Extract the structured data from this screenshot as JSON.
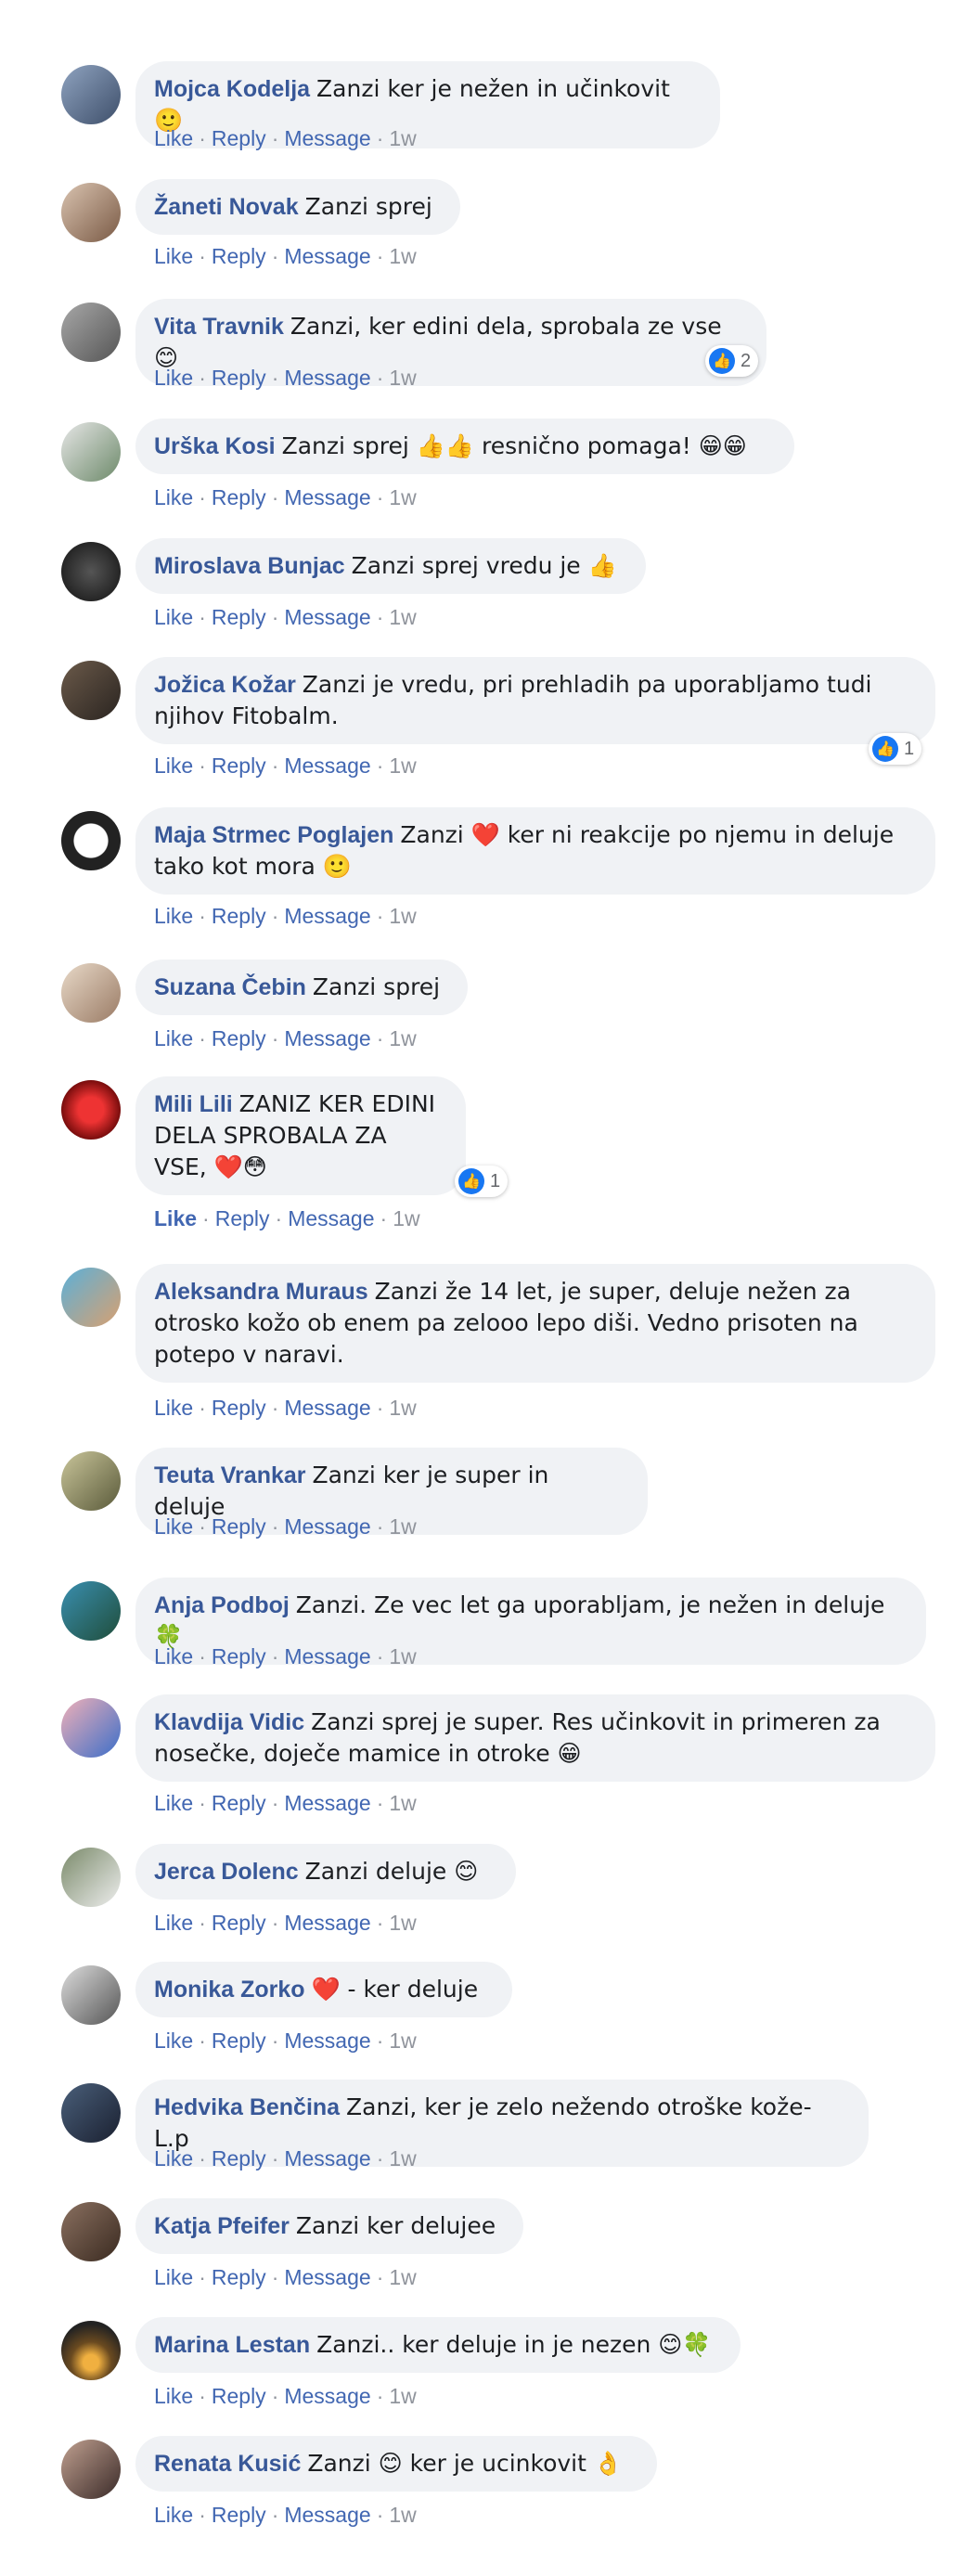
{
  "comments": [
    {
      "author": "Mojca Kodelja",
      "text": "Zanzi ker je nežen in učinkovit 🙂",
      "time": "1w",
      "reactions": ""
    },
    {
      "author": "Žaneti Novak",
      "text": "Zanzi sprej",
      "time": "1w",
      "reactions": ""
    },
    {
      "author": "Vita Travnik",
      "text": "Zanzi, ker edini dela, sprobala ze vse😊",
      "time": "1w",
      "reactions": "2"
    },
    {
      "author": "Urška Kosi",
      "text": "Zanzi sprej 👍👍 resnično pomaga! 😁😁",
      "time": "1w",
      "reactions": ""
    },
    {
      "author": "Miroslava Bunjac",
      "text": "Zanzi sprej vredu je 👍",
      "time": "1w",
      "reactions": ""
    },
    {
      "author": "Jožica Kožar",
      "text": "Zanzi je vredu, pri prehladih pa uporabljamo tudi njihov Fitobalm.",
      "time": "1w",
      "reactions": "1"
    },
    {
      "author": "Maja Strmec Poglajen",
      "text": "Zanzi ❤️ ker ni reakcije po njemu in deluje tako kot mora 🙂",
      "time": "1w",
      "reactions": ""
    },
    {
      "author": "Suzana Čebin",
      "text": "Zanzi sprej",
      "time": "1w",
      "reactions": ""
    },
    {
      "author": "Mili Lili",
      "text": "ZANIZ KER EDINI DELA SPROBALA ZA VSE, ❤️😳",
      "time": "1w",
      "reactions": "1"
    },
    {
      "author": "Aleksandra Muraus",
      "text": "Zanzi že 14 let, je super, deluje nežen za otrosko kožo ob enem pa zelooo lepo diši. Vedno prisoten na potepo v naravi.",
      "time": "1w",
      "reactions": ""
    },
    {
      "author": "Teuta Vrankar",
      "text": "Zanzi ker je super in deluje",
      "time": "1w",
      "reactions": ""
    },
    {
      "author": "Anja Podboj",
      "text": "Zanzi. Ze vec let ga uporabljam, je nežen in deluje🍀",
      "time": "1w",
      "reactions": ""
    },
    {
      "author": "Klavdija Vidic",
      "text": "Zanzi sprej je super. Res učinkovit in primeren za nosečke, doječe mamice in otroke 😁",
      "time": "1w",
      "reactions": ""
    },
    {
      "author": "Jerca Dolenc",
      "text": "Zanzi deluje 😊",
      "time": "1w",
      "reactions": ""
    },
    {
      "author": "Monika Zorko",
      "text": "❤️ - ker deluje",
      "time": "1w",
      "reactions": ""
    },
    {
      "author": "Hedvika Benčina",
      "text": "Zanzi, ker je zelo nežendo otroške kože-L.p",
      "time": "1w",
      "reactions": ""
    },
    {
      "author": "Katja Pfeifer",
      "text": "Zanzi ker delujee",
      "time": "1w",
      "reactions": ""
    },
    {
      "author": "Marina Lestan",
      "text": "Zanzi.. ker deluje in je nezen 😊🍀",
      "time": "1w",
      "reactions": ""
    },
    {
      "author": "Renata Kusić",
      "text": "Zanzi 😊 ker je ucinkovit 👌",
      "time": "1w",
      "reactions": ""
    }
  ],
  "actions": {
    "like": "Like",
    "reply": "Reply",
    "message": "Message",
    "sep": "·"
  },
  "colors": {
    "author": "#385898",
    "action": "#4267b2",
    "bubble": "#f0f2f5",
    "reaction": "#1877f2"
  }
}
